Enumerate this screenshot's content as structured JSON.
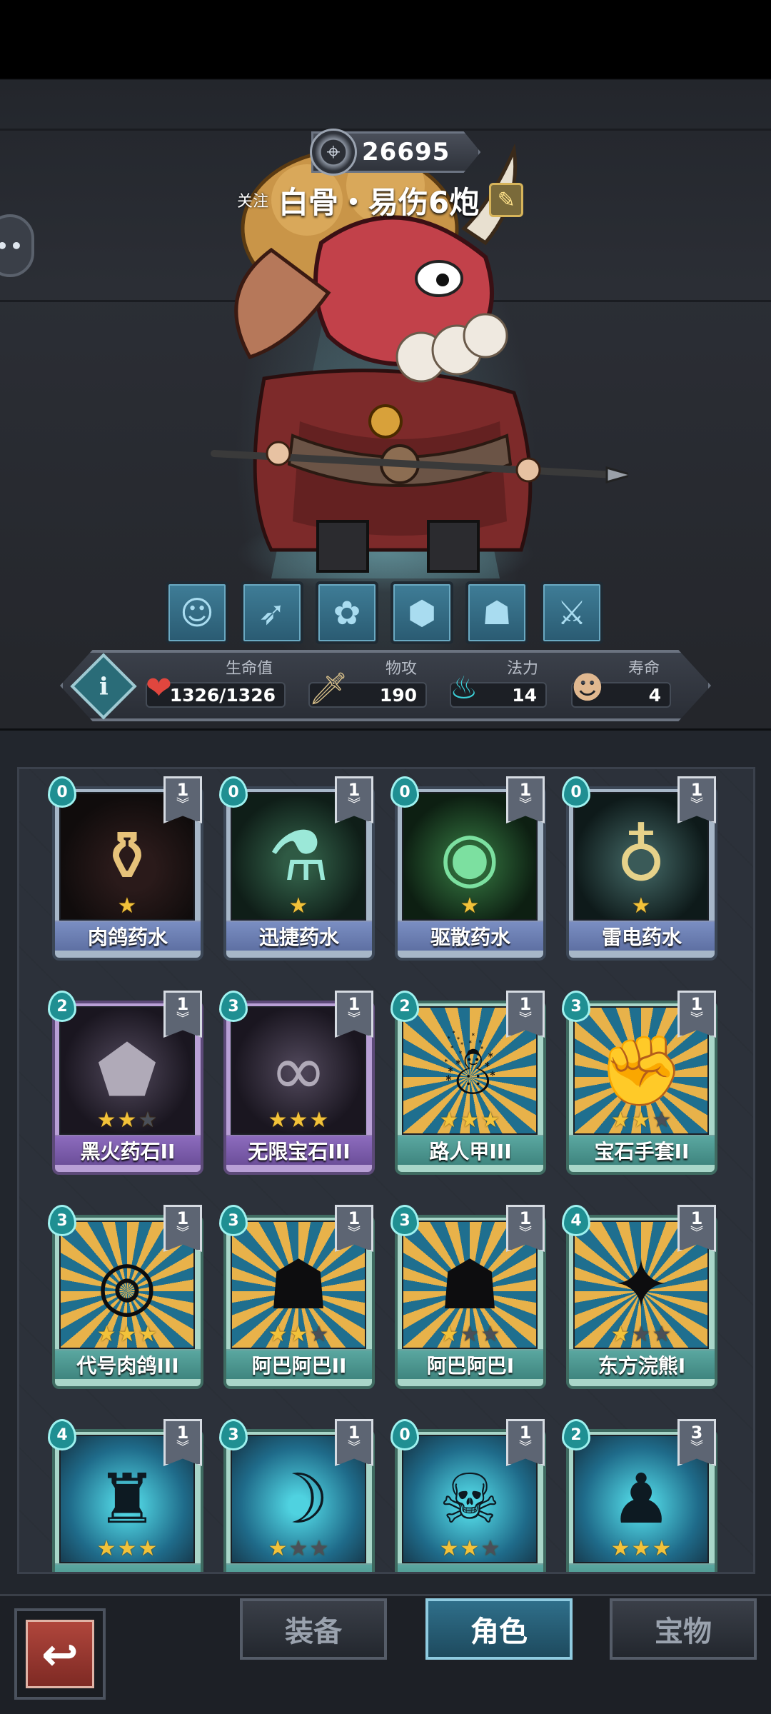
{
  "header": {
    "power_value": "26695",
    "follow_label": "关注",
    "character_name": "白骨・易伤6炮"
  },
  "left_bubble": "••",
  "abilities": [
    {
      "icon": "face-token-icon"
    },
    {
      "icon": "bow-icon"
    },
    {
      "icon": "rock-cluster-icon"
    },
    {
      "icon": "chest-icon"
    },
    {
      "icon": "mask-icon"
    },
    {
      "icon": "crossed-swords-icon"
    }
  ],
  "stats": {
    "hp_label": "生命值",
    "hp_value": "1326/1326",
    "atk_label": "物攻",
    "atk_value": "190",
    "mana_label": "法力",
    "mana_value": "14",
    "life_label": "寿命",
    "life_value": "4"
  },
  "cards": [
    {
      "name": "肉鸽药水",
      "cost": "0",
      "level": "1",
      "stars": 1,
      "max_stars": 1,
      "rarity": "blue",
      "art": "potion",
      "icon": "potion-icon"
    },
    {
      "name": "迅捷药水",
      "cost": "0",
      "level": "1",
      "stars": 1,
      "max_stars": 1,
      "rarity": "blue",
      "art": "green",
      "icon": "flask-icon"
    },
    {
      "name": "驱散药水",
      "cost": "0",
      "level": "1",
      "stars": 1,
      "max_stars": 1,
      "rarity": "blue",
      "art": "green2",
      "icon": "swirl-potion-icon"
    },
    {
      "name": "雷电药水",
      "cost": "0",
      "level": "1",
      "stars": 1,
      "max_stars": 1,
      "rarity": "blue",
      "art": "storm",
      "icon": "gourd-icon"
    },
    {
      "name": "黑火药石II",
      "cost": "2",
      "level": "1",
      "stars": 2,
      "max_stars": 3,
      "rarity": "purple",
      "art": "stone",
      "icon": "rune-stone-icon"
    },
    {
      "name": "无限宝石III",
      "cost": "3",
      "level": "1",
      "stars": 3,
      "max_stars": 3,
      "rarity": "purple",
      "art": "stone",
      "icon": "infinity-gem-icon"
    },
    {
      "name": "路人甲III",
      "cost": "2",
      "level": "1",
      "stars": 3,
      "max_stars": 3,
      "rarity": "teal",
      "art": "rays",
      "icon": "person-silhouette-icon"
    },
    {
      "name": "宝石手套II",
      "cost": "3",
      "level": "1",
      "stars": 2,
      "max_stars": 3,
      "rarity": "teal",
      "art": "rays",
      "icon": "gauntlet-icon"
    },
    {
      "name": "代号肉鸽III",
      "cost": "3",
      "level": "1",
      "stars": 3,
      "max_stars": 3,
      "rarity": "teal",
      "art": "rays",
      "icon": "badge-icon"
    },
    {
      "name": "阿巴阿巴II",
      "cost": "3",
      "level": "1",
      "stars": 2,
      "max_stars": 3,
      "rarity": "teal",
      "art": "rays",
      "icon": "blob-silhouette-icon"
    },
    {
      "name": "阿巴阿巴I",
      "cost": "3",
      "level": "1",
      "stars": 1,
      "max_stars": 3,
      "rarity": "teal",
      "art": "rays",
      "icon": "blob-silhouette-icon"
    },
    {
      "name": "东方浣熊I",
      "cost": "4",
      "level": "1",
      "stars": 1,
      "max_stars": 3,
      "rarity": "teal",
      "art": "rays",
      "icon": "raccoon-silhouette-icon"
    },
    {
      "name": "",
      "cost": "4",
      "level": "1",
      "stars": 3,
      "max_stars": 3,
      "rarity": "teal",
      "art": "cyan",
      "icon": "giant-silhouette-icon"
    },
    {
      "name": "",
      "cost": "3",
      "level": "1",
      "stars": 1,
      "max_stars": 3,
      "rarity": "teal",
      "art": "cyan",
      "icon": "spirit-icon"
    },
    {
      "name": "",
      "cost": "0",
      "level": "1",
      "stars": 2,
      "max_stars": 3,
      "rarity": "teal",
      "art": "cyan",
      "icon": "monster-icon"
    },
    {
      "name": "",
      "cost": "2",
      "level": "3",
      "stars": 3,
      "max_stars": 3,
      "rarity": "teal",
      "art": "cyan",
      "icon": "hooded-figure-icon"
    }
  ],
  "nav": {
    "back_icon": "back-arrow-icon",
    "tabs": [
      {
        "label": "装备",
        "active": false
      },
      {
        "label": "角色",
        "active": true
      },
      {
        "label": "宝物",
        "active": false
      }
    ]
  }
}
